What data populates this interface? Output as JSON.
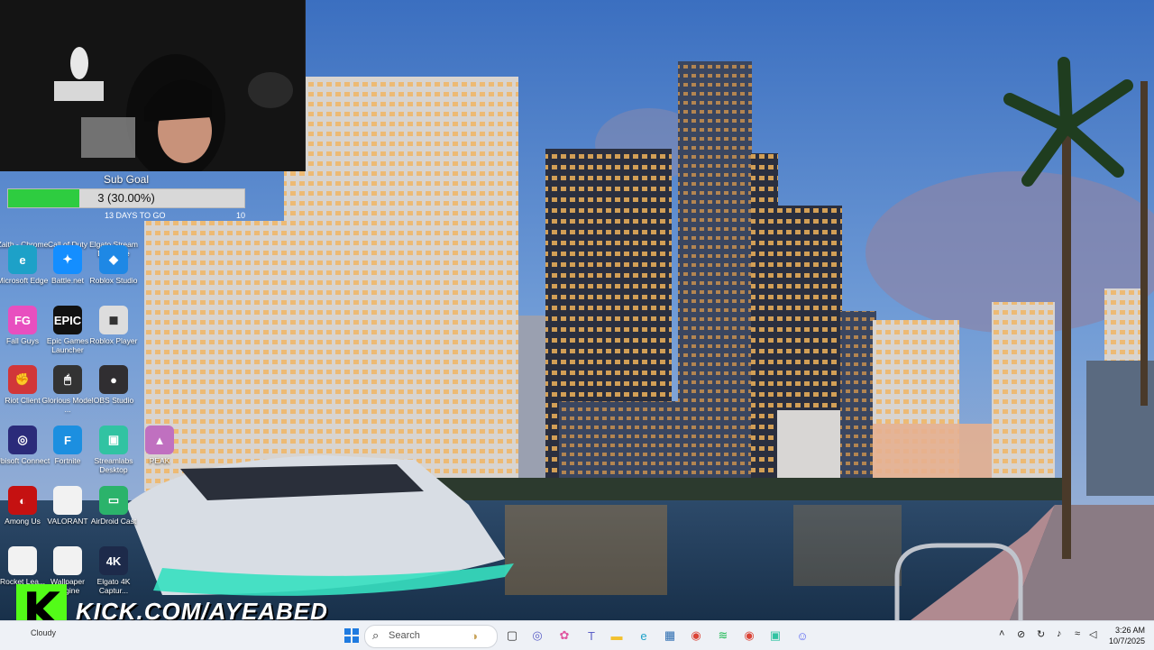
{
  "overlay": {
    "sub_goal": {
      "title": "Sub Goal",
      "progress_text": "3 (30.00%)",
      "progress": 0.3,
      "days_left": "13 DAYS TO GO",
      "target": "10"
    },
    "kick_url": "KICK.COM/AYEABED"
  },
  "desktop_icons": [
    {
      "label": "Zaith - Chrome",
      "glyph": "",
      "color": "#4285f4"
    },
    {
      "label": "Call of Duty",
      "glyph": "",
      "color": "#1a1a1a"
    },
    {
      "label": "Elgato Stream Deck.exe",
      "glyph": "",
      "color": "#222"
    },
    {
      "label": "Microsoft Edge",
      "glyph": "e",
      "color": "#1da1c8"
    },
    {
      "label": "Battle.net",
      "glyph": "✦",
      "color": "#148eff"
    },
    {
      "label": "Roblox Studio",
      "glyph": "◆",
      "color": "#1e88e5"
    },
    {
      "label": "Fall Guys",
      "glyph": "FG",
      "color": "#e84fbf"
    },
    {
      "label": "Epic Games Launcher",
      "glyph": "EPIC",
      "color": "#111"
    },
    {
      "label": "Roblox Player",
      "glyph": "◼",
      "color": "#ddd"
    },
    {
      "label": "Riot Client",
      "glyph": "✊",
      "color": "#d13639"
    },
    {
      "label": "Glorious Model ...",
      "glyph": "🖱",
      "color": "#333"
    },
    {
      "label": "OBS Studio",
      "glyph": "●",
      "color": "#302e31"
    },
    {
      "label": "Ubisoft Connect",
      "glyph": "◎",
      "color": "#2b2b7a"
    },
    {
      "label": "Fortnite",
      "glyph": "F",
      "color": "#1c8fe0"
    },
    {
      "label": "Streamlabs Desktop",
      "glyph": "▣",
      "color": "#31c3a2"
    },
    {
      "label": "PEAK",
      "glyph": "▲",
      "color": "#c070c0"
    },
    {
      "label": "Among Us",
      "glyph": "◐",
      "color": "#c51111"
    },
    {
      "label": "VALORANT",
      "glyph": "",
      "color": "#f2f2f2"
    },
    {
      "label": "AirDroid Cast",
      "glyph": "▭",
      "color": "#2bb36b"
    },
    {
      "label": "Rocket Lea...",
      "glyph": "",
      "color": "#f2f2f2"
    },
    {
      "label": "Wallpaper Engine",
      "glyph": "",
      "color": "#f2f2f2"
    },
    {
      "label": "Elgato 4K Captur...",
      "glyph": "4K",
      "color": "#1d2a4a"
    }
  ],
  "taskbar": {
    "weather": "Cloudy",
    "search_placeholder": "Search",
    "start_icon": "windows-start-icon",
    "pinned": [
      {
        "name": "widgets",
        "glyph": "◑",
        "color": "#c8a35a"
      },
      {
        "name": "task-view",
        "glyph": "▢",
        "color": "#333"
      },
      {
        "name": "copilot",
        "glyph": "◎",
        "color": "#5b5fc7"
      },
      {
        "name": "colorful-app",
        "glyph": "✿",
        "color": "#e056a0"
      },
      {
        "name": "teams",
        "glyph": "T",
        "color": "#5b5fc7"
      },
      {
        "name": "file-explorer",
        "glyph": "▬",
        "color": "#f2c12e"
      },
      {
        "name": "edge",
        "glyph": "e",
        "color": "#1da1c8"
      },
      {
        "name": "store",
        "glyph": "▦",
        "color": "#2b6cb0"
      },
      {
        "name": "chrome",
        "glyph": "◉",
        "color": "#db4437"
      },
      {
        "name": "spotify",
        "glyph": "≋",
        "color": "#1db954"
      },
      {
        "name": "chrome-active",
        "glyph": "◉",
        "color": "#db4437"
      },
      {
        "name": "streamlabs",
        "glyph": "▣",
        "color": "#31c3a2"
      },
      {
        "name": "discord",
        "glyph": "☺",
        "color": "#5865f2"
      }
    ],
    "time": "3:26 AM",
    "date": "10/7/2025"
  },
  "colors": {
    "kick_green": "#53fc18",
    "goal_green": "#2ecc40",
    "taskbar_bg": "#eef1f6"
  }
}
